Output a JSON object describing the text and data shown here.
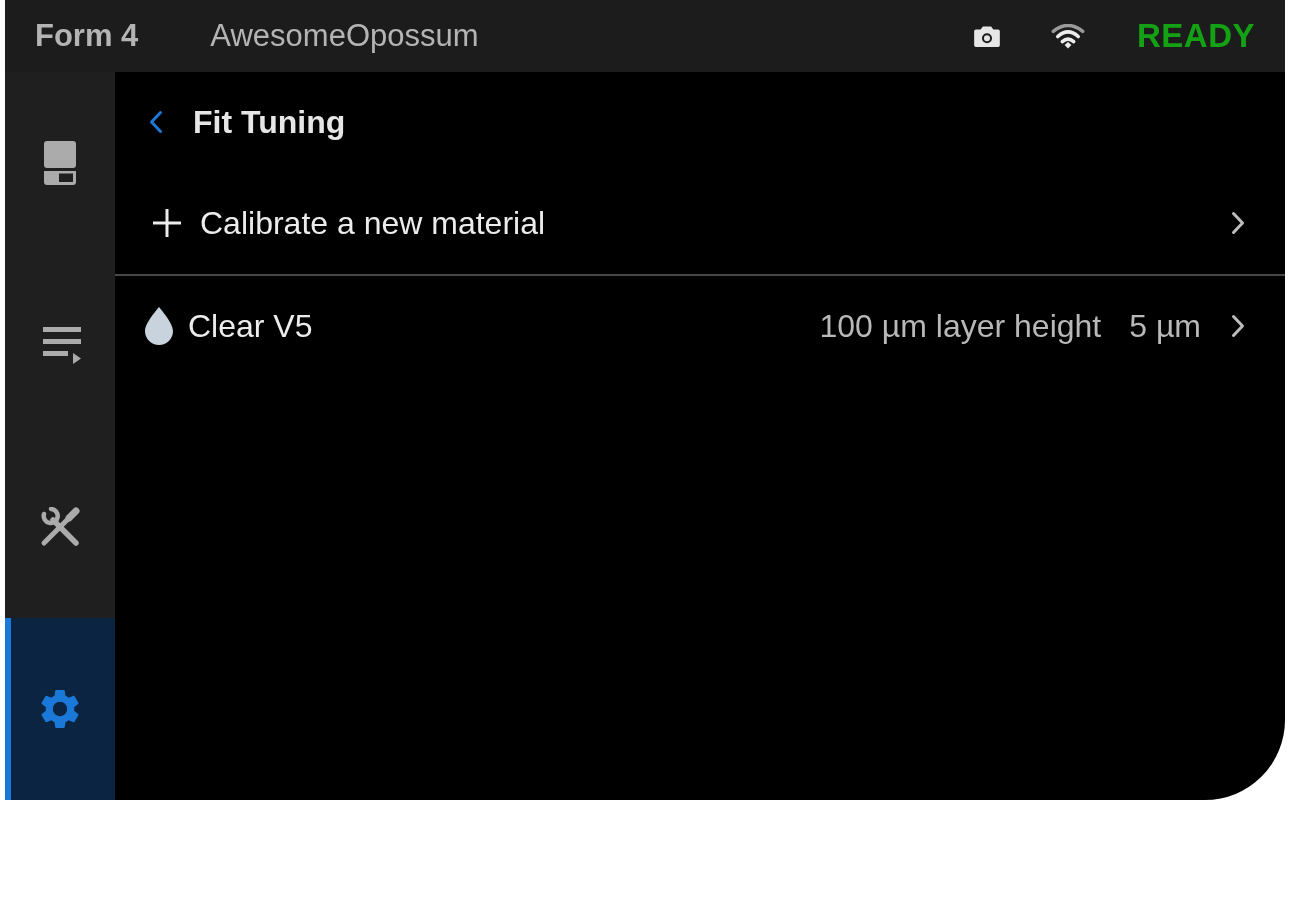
{
  "top_bar": {
    "model": "Form 4",
    "printer_name": "AwesomeOpossum",
    "status": "READY"
  },
  "sidebar": {
    "items": [
      {
        "kind": "printer",
        "selected": false
      },
      {
        "kind": "queue",
        "selected": false
      },
      {
        "kind": "tools",
        "selected": false
      },
      {
        "kind": "settings",
        "selected": true
      }
    ]
  },
  "page": {
    "title": "Fit Tuning",
    "add_row": {
      "label": "Calibrate a new material"
    },
    "materials": [
      {
        "name": "Clear V5",
        "layer_height": "100 µm layer height",
        "offset": "5 µm"
      }
    ]
  }
}
